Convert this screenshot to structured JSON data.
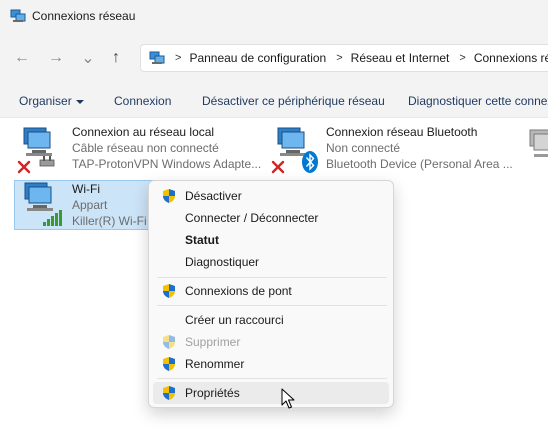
{
  "window": {
    "title": "Connexions réseau"
  },
  "nav": {
    "back_icon": "←",
    "forward_icon": "→",
    "dropdown_icon": "⌄",
    "up_icon": "↑"
  },
  "address": {
    "crumbs": [
      "Panneau de configuration",
      "Réseau et Internet",
      "Connexions réseau"
    ],
    "separator": ">"
  },
  "commands": {
    "organize": "Organiser",
    "connect": "Connexion",
    "disable": "Désactiver ce périphérique réseau",
    "diagnose": "Diagnostiquer cette connexion"
  },
  "connections": [
    {
      "name": "Connexion au réseau local",
      "status": "Câble réseau non connecté",
      "device": "TAP-ProtonVPN Windows Adapte..."
    },
    {
      "name": "Connexion réseau Bluetooth",
      "status": "Non connecté",
      "device": "Bluetooth Device (Personal Area ..."
    },
    {
      "name": "Wi-Fi",
      "status": "Appart",
      "device": "Killer(R) Wi-Fi"
    }
  ],
  "context_menu": {
    "disable": "Désactiver",
    "connect_disconnect": "Connecter / Déconnecter",
    "status": "Statut",
    "diagnose": "Diagnostiquer",
    "bridge": "Connexions de pont",
    "shortcut": "Créer un raccourci",
    "delete": "Supprimer",
    "rename": "Renommer",
    "properties": "Propriétés"
  },
  "colors": {
    "accent_blue": "#1e3a5f",
    "selection": "#cce4f7",
    "error_red": "#d42323",
    "bluetooth_blue": "#0078d4",
    "wifi_green": "#3a9a2f"
  }
}
